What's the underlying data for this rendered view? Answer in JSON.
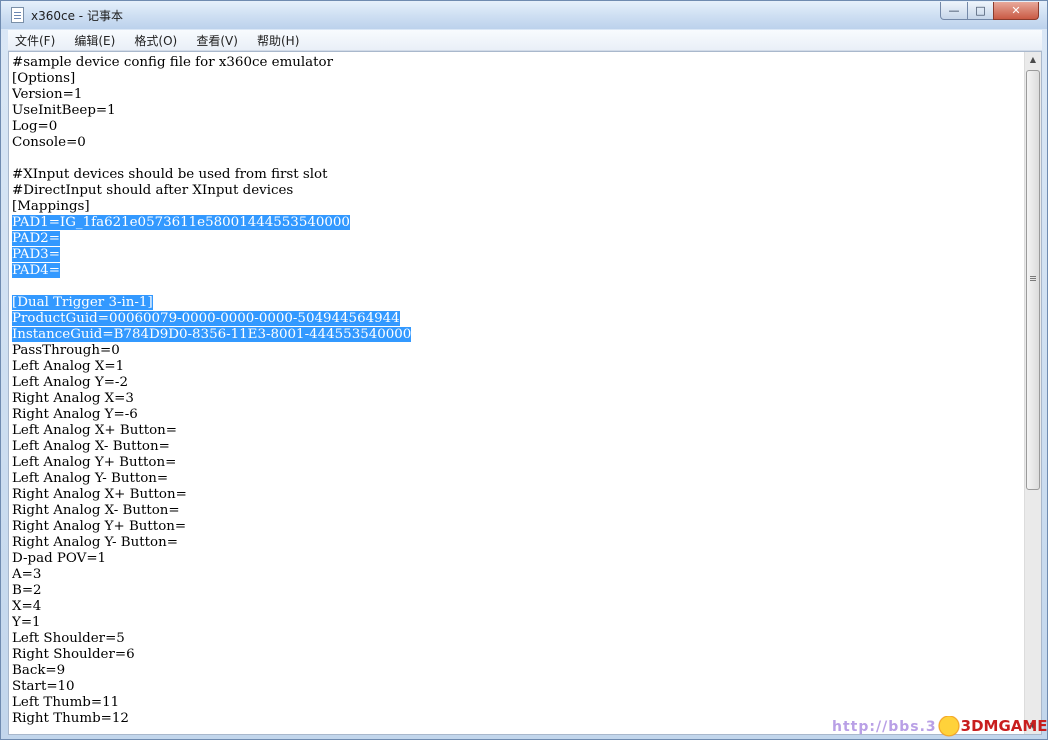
{
  "window": {
    "title": "x360ce - 记事本",
    "controls": {
      "minimize": "—",
      "maximize": "□",
      "close": "✕"
    }
  },
  "menu": [
    "文件(F)",
    "编辑(E)",
    "格式(O)",
    "查看(V)",
    "帮助(H)"
  ],
  "editor": {
    "lines": [
      {
        "text": "#sample device config file for x360ce emulator",
        "selected": false
      },
      {
        "text": "[Options]",
        "selected": false
      },
      {
        "text": "Version=1",
        "selected": false
      },
      {
        "text": "UseInitBeep=1",
        "selected": false
      },
      {
        "text": "Log=0",
        "selected": false
      },
      {
        "text": "Console=0",
        "selected": false
      },
      {
        "text": "",
        "selected": false
      },
      {
        "text": "#XInput devices should be used from first slot",
        "selected": false
      },
      {
        "text": "#DirectInput should after XInput devices",
        "selected": false
      },
      {
        "text": "[Mappings]",
        "selected": false
      },
      {
        "text": "PAD1=IG_1fa621e0573611e58001444553540000",
        "selected": true
      },
      {
        "text": "PAD2=",
        "selected": true
      },
      {
        "text": "PAD3=",
        "selected": true
      },
      {
        "text": "PAD4=",
        "selected": true
      },
      {
        "text": "",
        "selected": false
      },
      {
        "text": "[Dual Trigger 3-in-1]",
        "selected": true
      },
      {
        "text": "ProductGuid=00060079-0000-0000-0000-504944564944",
        "selected": true
      },
      {
        "text": "InstanceGuid=B784D9D0-8356-11E3-8001-444553540000",
        "selected": true
      },
      {
        "text": "PassThrough=0",
        "selected": false
      },
      {
        "text": "Left Analog X=1",
        "selected": false
      },
      {
        "text": "Left Analog Y=-2",
        "selected": false
      },
      {
        "text": "Right Analog X=3",
        "selected": false
      },
      {
        "text": "Right Analog Y=-6",
        "selected": false
      },
      {
        "text": "Left Analog X+ Button=",
        "selected": false
      },
      {
        "text": "Left Analog X- Button=",
        "selected": false
      },
      {
        "text": "Left Analog Y+ Button=",
        "selected": false
      },
      {
        "text": "Left Analog Y- Button=",
        "selected": false
      },
      {
        "text": "Right Analog X+ Button=",
        "selected": false
      },
      {
        "text": "Right Analog X- Button=",
        "selected": false
      },
      {
        "text": "Right Analog Y+ Button=",
        "selected": false
      },
      {
        "text": "Right Analog Y- Button=",
        "selected": false
      },
      {
        "text": "D-pad POV=1",
        "selected": false
      },
      {
        "text": "A=3",
        "selected": false
      },
      {
        "text": "B=2",
        "selected": false
      },
      {
        "text": "X=4",
        "selected": false
      },
      {
        "text": "Y=1",
        "selected": false
      },
      {
        "text": "Left Shoulder=5",
        "selected": false
      },
      {
        "text": "Right Shoulder=6",
        "selected": false
      },
      {
        "text": "Back=9",
        "selected": false
      },
      {
        "text": "Start=10",
        "selected": false
      },
      {
        "text": "Left Thumb=11",
        "selected": false
      },
      {
        "text": "Right Thumb=12",
        "selected": false
      }
    ]
  },
  "watermark": {
    "url": "http://bbs.3",
    "brand": "3DMGAME"
  },
  "colors": {
    "selection": "#3399ff",
    "title_gradient_top": "#e6f0fb",
    "close_button": "#c95a44"
  }
}
